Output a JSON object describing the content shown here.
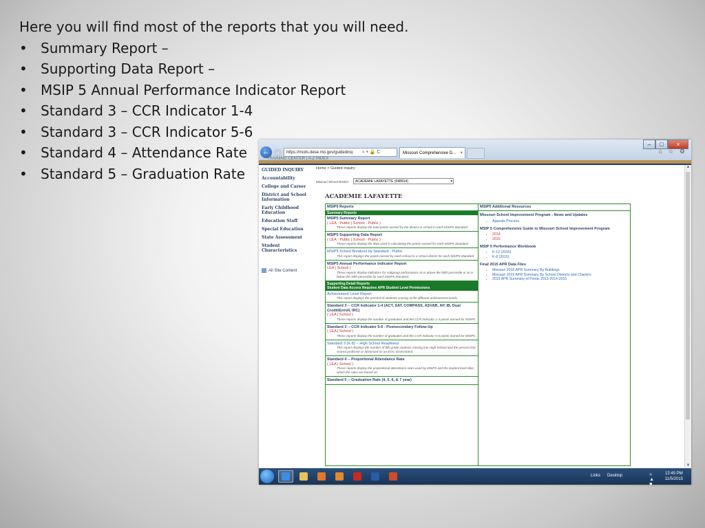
{
  "slide": {
    "intro": "Here you will find most of the reports that you will need.",
    "bullets": [
      "Summary Report –",
      "Supporting Data Report –",
      "MSIP 5 Annual Performance Indicator Report",
      "Standard 3 – CCR Indicator 1-4",
      "Standard 3 – CCR Indicator 5-6",
      "Standard 4 – Attendance Rate",
      "Standard 5 – Graduation Rate"
    ]
  },
  "browser": {
    "address": "https://mcds.dese.mo.gov/guidedinq",
    "address_icons": "⌕ ▾ 🔒 C",
    "tab_title": "Missouri Comprehensive D...",
    "tab_close": "×",
    "toolbar_icons": "⌂ ☆ ⚙",
    "back": "←",
    "forward": "→",
    "window_buttons": {
      "min": "–",
      "max": "□",
      "close": "×"
    }
  },
  "site": {
    "top_links": "TRAINING CENTER  |  A-Z INDEX",
    "nav": [
      "GUIDED INQUIRY",
      "Accountability",
      "College and Career",
      "District and School Information",
      "Early Childhood Education",
      "Education Staff",
      "Special Education",
      "State Assessment",
      "Student Characteristics"
    ],
    "all_site": "All Site Content",
    "breadcrumb": "Home > Guided Inquiry",
    "district_label": "Missouri School District",
    "district_value": "ACADEMIE LAFAYETTE (048914)",
    "district_title": "ACADEMIE LAFAYETTE"
  },
  "reports": {
    "left_header": "MSIP5 Reports",
    "right_header": "MSIP5 Additional Resources",
    "summary_bar": "Summary Reports",
    "summary": [
      {
        "title": "MSIP5 Summary Report",
        "links": "( LEA - Public | School - Public )",
        "desc": "These reports display the total points earned by the district or school in each MSIP5 Standard."
      },
      {
        "title": "MSIP5 Supporting Data Report",
        "links": "( LEA - Public | School - Public )",
        "desc": "These reports display the data used in calculating the points earned for each MSIP5 Standard."
      },
      {
        "title": "",
        "links": "MSIP5 School Breakout by Standard - Public",
        "desc": "This report displays the points earned by each school in a school district for each MSIP5 Standard."
      },
      {
        "title": "MSIP5 Annual Performance Indicator Report",
        "links": "LEA | School )",
        "desc": "These reports display indicators for subgroup performance at or above the 90th percentile or at or below the 10th percentile for each MSIP5 Standard."
      }
    ],
    "detail_bar1": "Supporting Detail Reports",
    "detail_bar2": "Student Data Access Requires APR Student Level Permissions",
    "detail": [
      {
        "title": "",
        "links": "Achievement Level Report",
        "desc": "This report displays the percent of students scoring at the different achievement levels."
      },
      {
        "title": "Standard 3 -- CCR Indicator 1-4 (ACT, SAT, COMPASS, ASVAB, AP, IB, Dual Credit/Enroll, IRC)",
        "links": "( LEA | School )",
        "desc": "These reports display the number of graduates and the CCR Indicator 1-4 points earned for MSIP5."
      },
      {
        "title": "Standard 3 -- CCR Indicator 5-6 - Postsecondary Follow-Up",
        "links": "( LEA | School )",
        "desc": "These reports display the number of graduates and the CCR Indicator 5-6 points earned for MSIP5."
      },
      {
        "title": "",
        "links": "Standard 3 (K-8) -- High School Readiness",
        "desc": "This report displays the number of 8th grade students moving into High School and the percent that scored proficient or advanced on an EOC assessment."
      },
      {
        "title": "Standard 4 -- Proportional Attendance Rate",
        "links": "( LEA | School )",
        "desc": "These reports display the proportional attendance rates used by MSIP5 and the student level data which the rates are based on."
      },
      {
        "title": "Standard 5 -- Graduation Rate (4, 5, 6, & 7 year)",
        "links": "",
        "desc": ""
      }
    ],
    "resources": [
      {
        "title": "Missouri School Improvement Program - News and Updates",
        "items": [
          "Appeals Process"
        ],
        "blue": true
      },
      {
        "title": "MSIP 5 Comprehensive Guide to Missouri School Improvement Program",
        "items": [
          "2014",
          "2015"
        ],
        "blue": false
      },
      {
        "title": "MSIP 5 Performance Workbook",
        "items": [
          "K-12 (2015)",
          "K-8 (2015)"
        ],
        "blue": true
      },
      {
        "title": "Final 2015 APR Data Files",
        "items": [
          "Missouri 2015 APR Summary By Buildings",
          "Missouri 2015 APR Summary By School Districts and Charters",
          "2015 APR Summary of Points 2013-2014-2015"
        ],
        "blue": true
      }
    ]
  },
  "taskbar": {
    "links": "Links",
    "desktop": "Desktop",
    "sys_icons": "» ▲ ■ ▮",
    "time": "12:45 PM",
    "date": "11/5/2015",
    "apps": [
      {
        "icon": "ie-icon",
        "color": "#3a8fe0",
        "active": true
      },
      {
        "icon": "folder-icon",
        "color": "#e9c25a",
        "active": false
      },
      {
        "icon": "media-player-icon",
        "color": "#e0782a",
        "active": false
      },
      {
        "icon": "outlook-icon",
        "color": "#e08a2a",
        "active": false
      },
      {
        "icon": "acrobat-icon",
        "color": "#c8281e",
        "active": false
      },
      {
        "icon": "word-icon",
        "color": "#2a5aa8",
        "active": false
      },
      {
        "icon": "powerpoint-icon",
        "color": "#d24a28",
        "active": false
      }
    ]
  }
}
